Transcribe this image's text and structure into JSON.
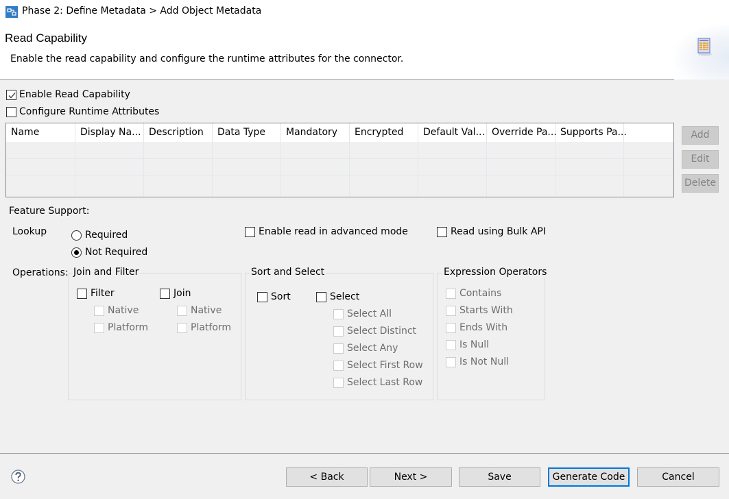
{
  "window": {
    "title": "Phase 2: Define Metadata > Add Object Metadata",
    "icon": "wizard-app-icon"
  },
  "header": {
    "title": "Read Capability",
    "description": "Enable the read capability and configure the runtime attributes for the connector.",
    "icon": "table-document-icon"
  },
  "options": {
    "enable_read": {
      "label": "Enable Read Capability",
      "checked": true
    },
    "configure_runtime": {
      "label": "Configure Runtime Attributes",
      "checked": false
    }
  },
  "table": {
    "columns": [
      "Name",
      "Display Na...",
      "Description",
      "Data Type",
      "Mandatory",
      "Encrypted",
      "Default Val...",
      "Override Pa...",
      "Supports Pa..."
    ],
    "rows": []
  },
  "side_buttons": {
    "add": "Add",
    "edit": "Edit",
    "delete": "Delete"
  },
  "feature_support": {
    "label": "Feature Support:",
    "lookup": {
      "label": "Lookup",
      "options": [
        {
          "label": "Required",
          "selected": false
        },
        {
          "label": "Not Required",
          "selected": true
        }
      ]
    },
    "advanced_mode": {
      "label": "Enable read in advanced mode",
      "checked": false
    },
    "bulk_api": {
      "label": "Read using Bulk API",
      "checked": false
    }
  },
  "operations": {
    "label": "Operations:",
    "join_filter": {
      "title": "Join and Filter",
      "filter": {
        "label": "Filter",
        "checked": false,
        "sub": [
          "Native",
          "Platform"
        ]
      },
      "join": {
        "label": "Join",
        "checked": false,
        "sub": [
          "Native",
          "Platform"
        ]
      }
    },
    "sort_select": {
      "title": "Sort and Select",
      "sort": {
        "label": "Sort",
        "checked": false
      },
      "select": {
        "label": "Select",
        "checked": false,
        "sub": [
          "Select All",
          "Select Distinct",
          "Select Any",
          "Select First Row",
          "Select Last Row"
        ]
      }
    },
    "expression_operators": {
      "title": "Expression Operators",
      "items": [
        "Contains",
        "Starts With",
        "Ends With",
        "Is Null",
        "Is Not Null"
      ]
    }
  },
  "footer": {
    "back": "< Back",
    "next": "Next >",
    "save": "Save",
    "generate": "Generate Code",
    "cancel": "Cancel"
  },
  "colors": {
    "accent": "#0078d7",
    "disabled_text": "#6d6d6d"
  }
}
